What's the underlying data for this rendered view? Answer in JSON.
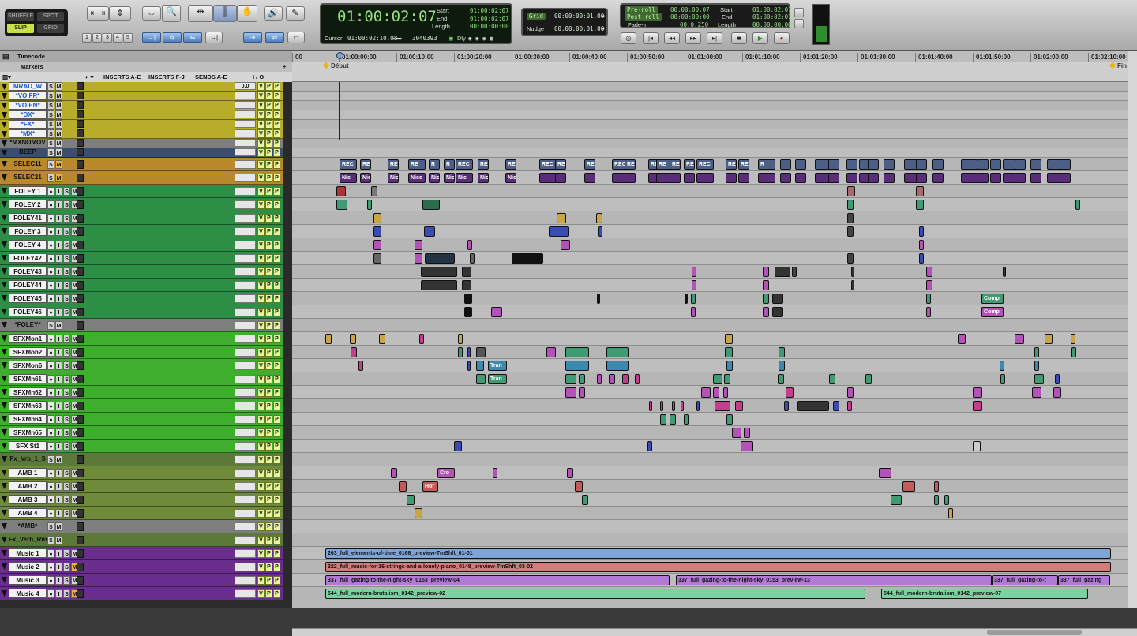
{
  "modes": {
    "shuffle": "SHUFFLE",
    "spot": "SPOT",
    "slip": "SLIP",
    "grid": "GRID"
  },
  "zoom_presets": [
    "1",
    "2",
    "3",
    "4",
    "5"
  ],
  "counter": {
    "main": "01:00:02:07",
    "start_label": "Start",
    "end_label": "End",
    "length_label": "Length",
    "start": "01:00:02:07",
    "end": "01:00:02:07",
    "length": "00:00:00:00",
    "cursor_label": "Cursor",
    "cursor": "01:00:02:10.08",
    "samples": "3040393",
    "dly": "Dly"
  },
  "grid": {
    "grid_label": "Grid",
    "grid_value": "00:00:00:01.00",
    "nudge_label": "Nudge",
    "nudge_value": "00:00:00:01.00"
  },
  "preroll": {
    "pre_label": "Pre-roll",
    "post_label": "Post-roll",
    "fade_label": "Fade-in",
    "pre": "00:00:00:07",
    "post": "00:00:00:00",
    "fade": "00:0.250",
    "start_label": "Start",
    "end_label": "End",
    "length_label": "Length",
    "start": "01:00:02:07",
    "end": "01:00:02:07",
    "length": "00:00:00:00"
  },
  "headers": {
    "timecode": "Timecode",
    "markers": "Markers",
    "inserts_ae": "INSERTS A-E",
    "inserts_fj": "INSERTS F-J",
    "sends_ae": "SENDS A-E",
    "io": "I / O"
  },
  "ruler_ticks": [
    "00",
    "01:00:00:00",
    "01:00:10:00",
    "01:00:20:00",
    "01:00:30:00",
    "01:00:40:00",
    "01:00:50:00",
    "01:01:00:00",
    "01:01:10:00",
    "01:01:20:00",
    "01:01:30:00",
    "01:01:40:00",
    "01:01:50:00",
    "01:02:00:00",
    "01:02:10:00"
  ],
  "markers": {
    "debut": "Début",
    "fin": "Fin"
  },
  "tracks": [
    {
      "name": "MRAD_W",
      "color": "#b8ad2a",
      "style": "blue",
      "io": "0.0",
      "controls": "vol read"
    },
    {
      "name": "*VO FR*",
      "color": "#b8ad2a",
      "style": "blue"
    },
    {
      "name": "*VO EN*",
      "color": "#b8ad2a",
      "style": "blue"
    },
    {
      "name": "*DX*",
      "color": "#b8ad2a",
      "style": "blue"
    },
    {
      "name": "*FX*",
      "color": "#b8ad2a",
      "style": "blue"
    },
    {
      "name": "*MX*",
      "color": "#b8ad2a",
      "style": "blue"
    },
    {
      "name": "*MXNOMOV",
      "color": "#7e7e7e",
      "style": "dark"
    },
    {
      "name": "BEEP",
      "color": "#3b4f6b",
      "style": "dark"
    },
    {
      "name": "SELEC11",
      "color": "#b98a2c",
      "style": "dark"
    },
    {
      "name": "SELEC21",
      "color": "#b98a2c",
      "style": "dark"
    },
    {
      "name": "FOLEY 1",
      "color": "#2d8f46",
      "style": "normal"
    },
    {
      "name": "FOLEY 2",
      "color": "#2d8f46",
      "style": "normal"
    },
    {
      "name": "FOLEY41",
      "color": "#2d8f46",
      "style": "normal"
    },
    {
      "name": "FOLEY 3",
      "color": "#2d8f46",
      "style": "normal"
    },
    {
      "name": "FOLEY 4",
      "color": "#2d8f46",
      "style": "normal"
    },
    {
      "name": "FOLEY42",
      "color": "#2d8f46",
      "style": "normal"
    },
    {
      "name": "FOLEY43",
      "color": "#2d8f46",
      "style": "normal"
    },
    {
      "name": "FOLEY44",
      "color": "#2d8f46",
      "style": "normal"
    },
    {
      "name": "FOLEY45",
      "color": "#2d8f46",
      "style": "normal"
    },
    {
      "name": "FOLEY46",
      "color": "#2d8f46",
      "style": "normal"
    },
    {
      "name": "*FOLEY*",
      "color": "#7e7e7e",
      "style": "dark"
    },
    {
      "name": "SFXMon1",
      "color": "#3fae2e",
      "style": "normal"
    },
    {
      "name": "SFXMon2",
      "color": "#3fae2e",
      "style": "normal"
    },
    {
      "name": "SFXMon6",
      "color": "#3fae2e",
      "style": "normal"
    },
    {
      "name": "SFXMn61",
      "color": "#3fae2e",
      "style": "normal"
    },
    {
      "name": "SFXMn62",
      "color": "#3fae2e",
      "style": "normal"
    },
    {
      "name": "SFXMn63",
      "color": "#3fae2e",
      "style": "normal"
    },
    {
      "name": "SFXMn64",
      "color": "#3fae2e",
      "style": "normal"
    },
    {
      "name": "SFXMn65",
      "color": "#3fae2e",
      "style": "normal"
    },
    {
      "name": "SFX St1",
      "color": "#3fae2e",
      "style": "normal"
    },
    {
      "name": "Fx_Vrb_1_S",
      "color": "#5b7a3a",
      "style": "dark"
    },
    {
      "name": "AMB 1",
      "color": "#6e8a3a",
      "style": "normal"
    },
    {
      "name": "AMB 2",
      "color": "#6e8a3a",
      "style": "normal"
    },
    {
      "name": "AMB 3",
      "color": "#6e8a3a",
      "style": "normal"
    },
    {
      "name": "AMB 4",
      "color": "#6e8a3a",
      "style": "normal"
    },
    {
      "name": "*AMB*",
      "color": "#7e7e7e",
      "style": "dark"
    },
    {
      "name": "Fx_Verb_Rm",
      "color": "#5b7a3a",
      "style": "dark"
    },
    {
      "name": "Music 1",
      "color": "#6a2e8f",
      "style": "normal"
    },
    {
      "name": "Music 2",
      "color": "#6a2e8f",
      "style": "normal"
    },
    {
      "name": "Music 3",
      "color": "#6a2e8f",
      "style": "normal"
    },
    {
      "name": "Music 4",
      "color": "#6a2e8f",
      "style": "normal"
    }
  ],
  "clips": {
    "selec11": [
      "REC",
      "REC_07",
      "REC",
      "RE",
      "R",
      "R",
      "REC_10-04",
      "REC",
      "RE",
      "REC",
      "REC",
      "REC_26-",
      "REC",
      "REC",
      "RE",
      "RE",
      "REC",
      "RE",
      "REC",
      "RE",
      "REC",
      "R"
    ],
    "selec21": [
      "Nic",
      "Nic",
      "Nico",
      "Nico",
      "Nicol",
      "Nicol",
      "Nic",
      "Nicola",
      "Nic"
    ],
    "foley45": "Comp",
    "foley46": "Comp",
    "sfxmon6": "Tran",
    "sfxmn61": "Tran",
    "amb1": "Cro",
    "amb2": "Hor",
    "music1": "263_full_elements-of-time_0168_preview-TmShft_01-01",
    "music2": "322_full_music-for-16-strings-and-a-lonely-piano_0148_preview-TmShft_03-02",
    "music3a": "337_full_gazing-to-the-night-sky_0153_preview-04",
    "music3b": "337_full_gazing-to-the-night-sky_0153_preview-13",
    "music3c": "337_full_gazing-to-t",
    "music3d": "337_full_gazing",
    "music4a": "544_full_modern-brutalism_0142_preview-02",
    "music4b": "544_full_modern-brutalism_0142_preview-07"
  }
}
